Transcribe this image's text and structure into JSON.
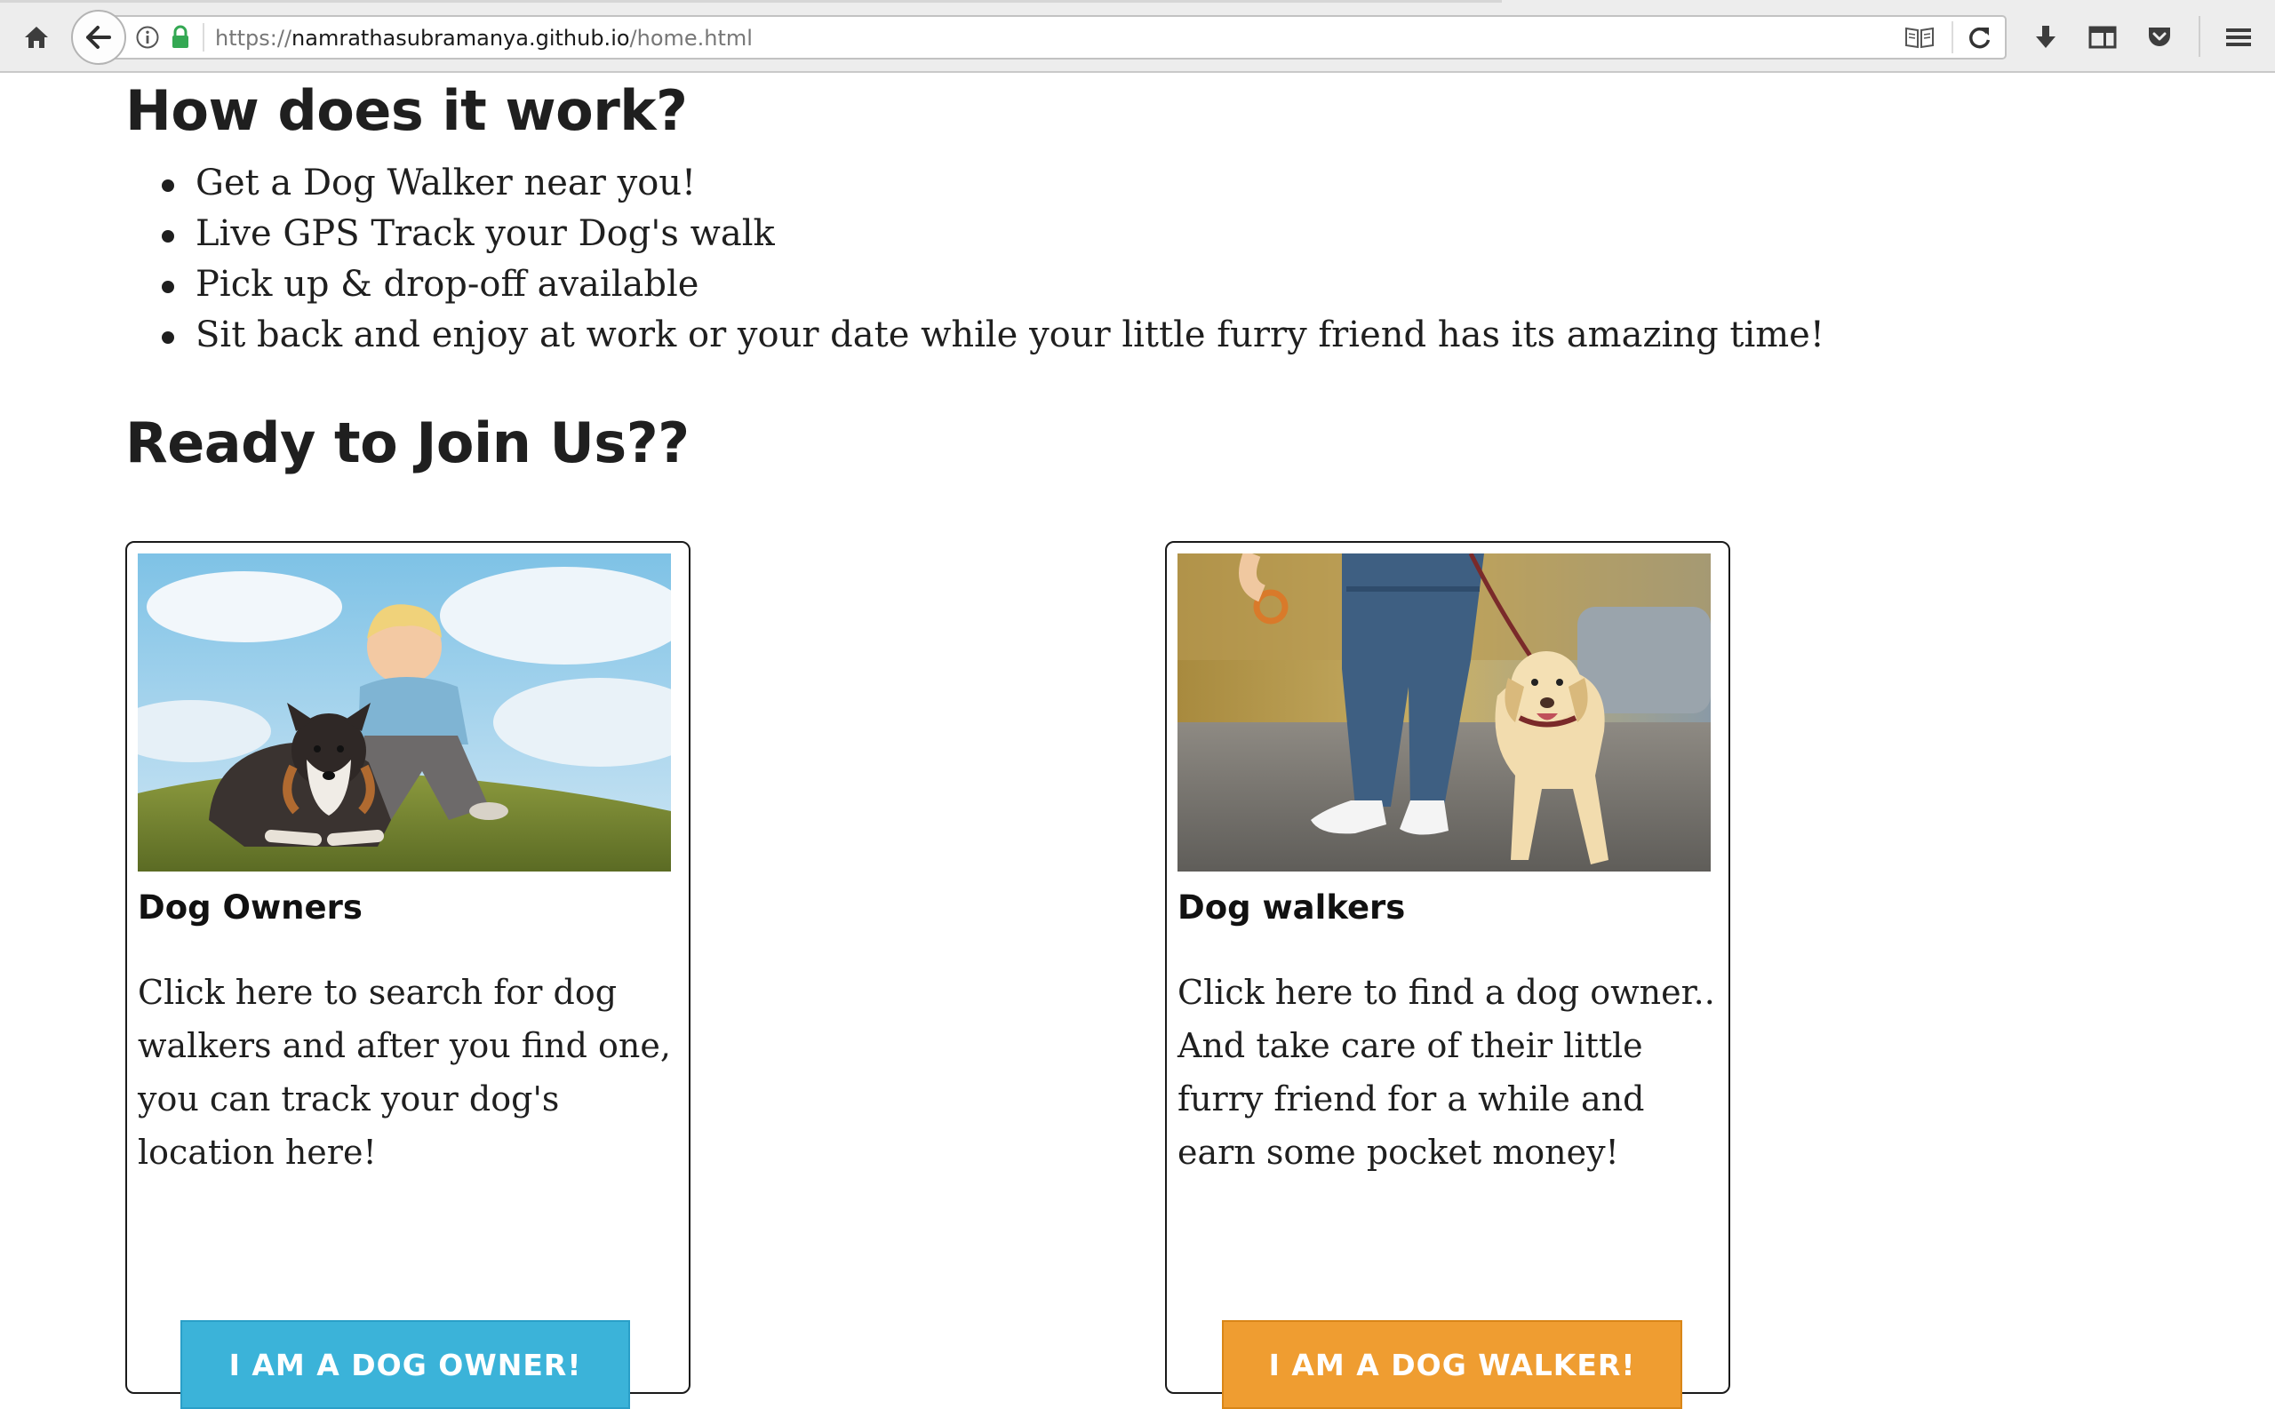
{
  "browser": {
    "url_scheme": "https://",
    "url_host": "namrathasubramanya.github.io",
    "url_path": "/home.html",
    "icons": [
      "home-icon",
      "back-arrow-icon",
      "info-icon",
      "lock-icon",
      "reader-view-icon",
      "reload-icon",
      "download-icon",
      "library-icon",
      "pocket-icon",
      "hamburger-menu-icon"
    ]
  },
  "how": {
    "heading": "How does it work?",
    "items": [
      "Get a Dog Walker near you!",
      "Live GPS Track your Dog's walk",
      "Pick up & drop-off available",
      "Sit back and enjoy at work or your date while your little furry friend has its amazing time!"
    ]
  },
  "join": {
    "heading": "Ready to Join Us??",
    "cards": [
      {
        "title": "Dog Owners",
        "description": "Click here to search for dog walkers and after you find one, you can track your dog's location here!",
        "button": "I AM A DOG OWNER!",
        "button_color": "#3bb3d9"
      },
      {
        "title": "Dog walkers",
        "description": "Click here to find a dog owner.. And take care of their little furry friend for a while and earn some pocket money!",
        "button": "I AM A DOG WALKER!",
        "button_color": "#ef9d31"
      }
    ]
  }
}
